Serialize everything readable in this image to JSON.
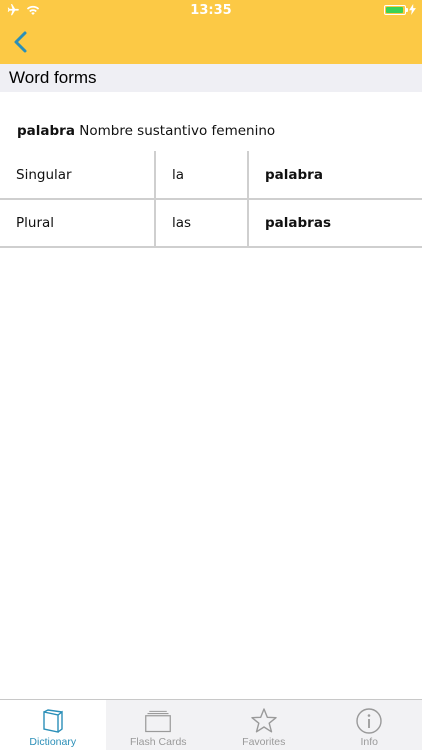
{
  "colors": {
    "accent": "#fcc945",
    "tint": "#2b8fb8",
    "battery": "#3bd255",
    "section_bg": "#efeff4",
    "tab_inactive": "#9a9a9a"
  },
  "status_bar": {
    "time": "13:35",
    "battery_level": 0.95
  },
  "nav": {
    "back_icon": "chevron-left-icon"
  },
  "section": {
    "title": "Word forms"
  },
  "word": {
    "lemma": "palabra",
    "description": "Nombre sustantivo femenino"
  },
  "forms": [
    {
      "label": "Singular",
      "article": "la",
      "form": "palabra"
    },
    {
      "label": "Plural",
      "article": "las",
      "form": "palabras"
    }
  ],
  "tabs": [
    {
      "label": "Dictionary",
      "icon": "book-icon",
      "active": true
    },
    {
      "label": "Flash Cards",
      "icon": "cards-icon",
      "active": false
    },
    {
      "label": "Favorites",
      "icon": "star-icon",
      "active": false
    },
    {
      "label": "Info",
      "icon": "info-icon",
      "active": false
    }
  ]
}
